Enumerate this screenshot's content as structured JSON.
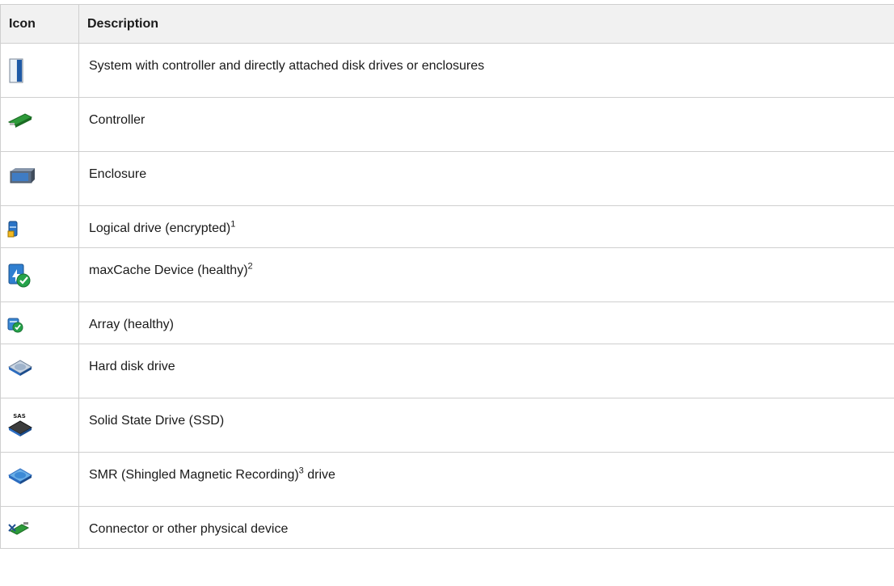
{
  "table": {
    "headers": {
      "icon": "Icon",
      "description": "Description"
    },
    "rows": [
      {
        "icon": "system-icon",
        "text": "System with controller and directly attached disk drives or enclosures",
        "sup": "",
        "suffix": ""
      },
      {
        "icon": "controller-icon",
        "text": "Controller",
        "sup": "",
        "suffix": ""
      },
      {
        "icon": "enclosure-icon",
        "text": "Enclosure",
        "sup": "",
        "suffix": ""
      },
      {
        "icon": "logical-drive-encrypted-icon",
        "text": "Logical drive (encrypted)",
        "sup": "1",
        "suffix": ""
      },
      {
        "icon": "maxcache-device-healthy-icon",
        "text": "maxCache Device (healthy)",
        "sup": "2",
        "suffix": ""
      },
      {
        "icon": "array-healthy-icon",
        "text": "Array (healthy)",
        "sup": "",
        "suffix": ""
      },
      {
        "icon": "hard-disk-drive-icon",
        "text": "Hard disk drive",
        "sup": "",
        "suffix": ""
      },
      {
        "icon": "ssd-icon",
        "text": "Solid State Drive (SSD)",
        "sup": "",
        "suffix": ""
      },
      {
        "icon": "smr-drive-icon",
        "text": "SMR (Shingled Magnetic Recording)",
        "sup": "3",
        "suffix": " drive"
      },
      {
        "icon": "connector-icon",
        "text": "Connector or other physical device",
        "sup": "",
        "suffix": ""
      }
    ]
  }
}
